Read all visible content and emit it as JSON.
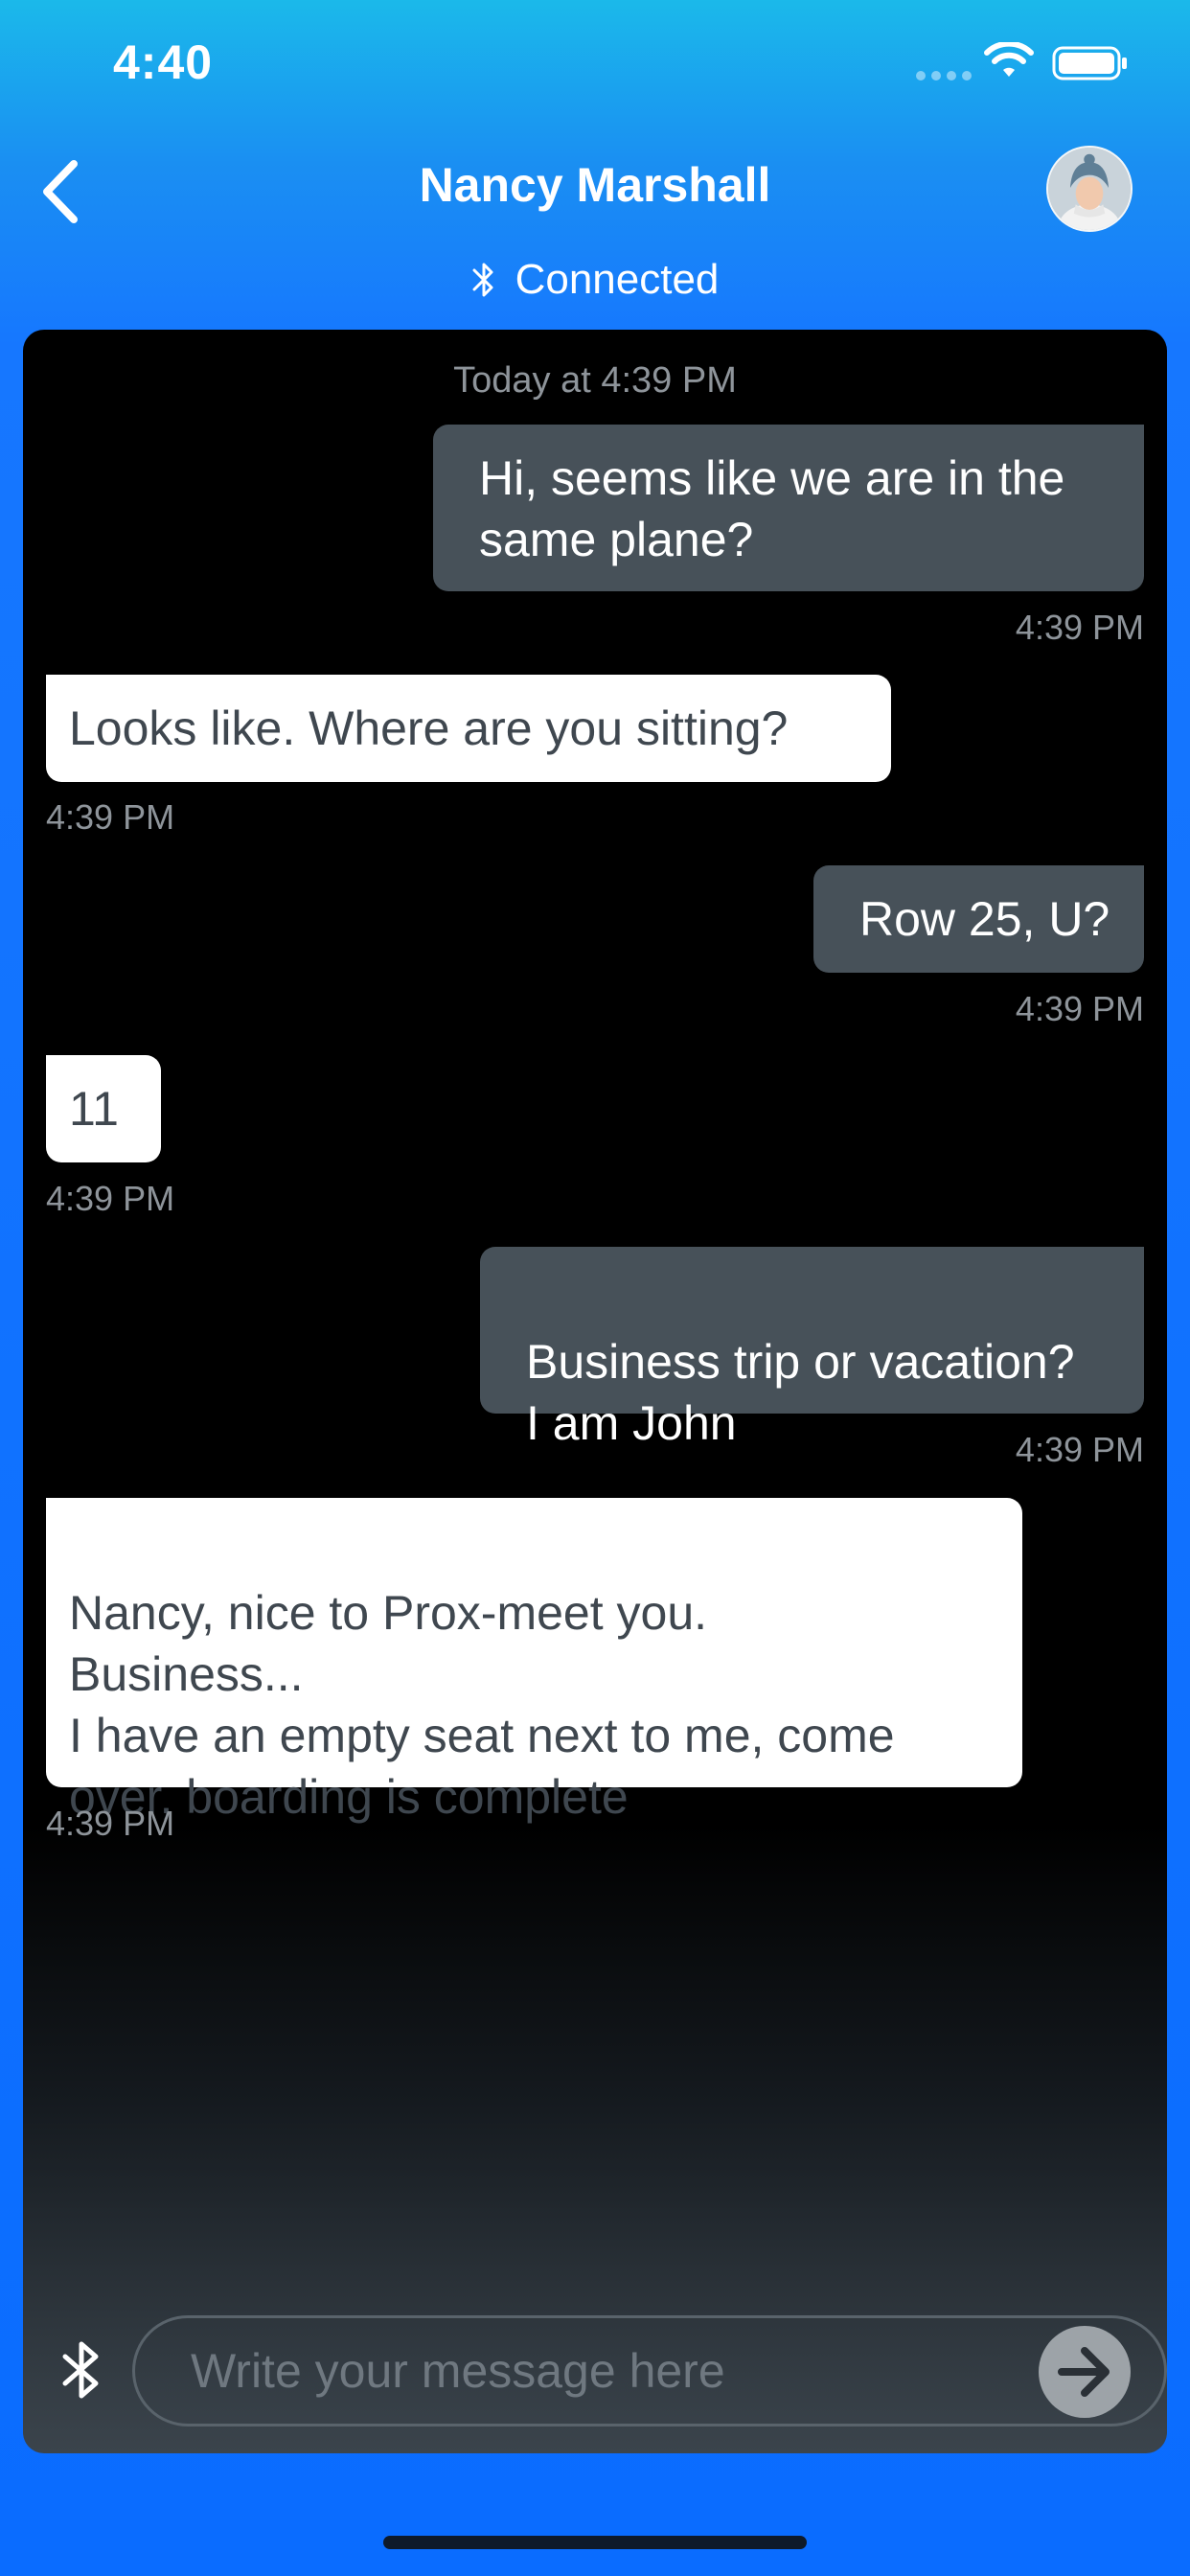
{
  "status_bar": {
    "time": "4:40",
    "icons": [
      "signal-dots-icon",
      "wifi-icon",
      "battery-icon"
    ]
  },
  "header": {
    "back_icon": "chevron-left-icon",
    "contact_name": "Nancy Marshall",
    "avatar_icon": "user-avatar",
    "connection_icon": "bluetooth-icon",
    "connection_status": "Connected"
  },
  "chat": {
    "date_stamp": "Today at 4:39 PM",
    "messages": [
      {
        "direction": "out",
        "text": "Hi, seems like we are in the same plane?",
        "time": "4:39 PM"
      },
      {
        "direction": "in",
        "text": "Looks like. Where are you sitting?",
        "time": "4:39 PM"
      },
      {
        "direction": "out",
        "text": "Row 25, U?",
        "time": "4:39 PM"
      },
      {
        "direction": "in",
        "text": "11",
        "time": "4:39 PM"
      },
      {
        "direction": "out",
        "text": "Business trip or vacation?\nI am John",
        "time": "4:39 PM"
      },
      {
        "direction": "in",
        "text": "Nancy, nice to Prox-meet you.\nBusiness...\nI have an empty seat next to me, come over, boarding is complete",
        "time": "4:39 PM"
      }
    ]
  },
  "composer": {
    "bluetooth_icon": "bluetooth-icon",
    "placeholder": "Write your message here",
    "value": "",
    "send_icon": "arrow-right-icon"
  },
  "colors": {
    "background": "#1677ff",
    "outgoing_bubble": "#475159",
    "incoming_bubble": "#ffffff",
    "timestamp": "#8e949a"
  }
}
